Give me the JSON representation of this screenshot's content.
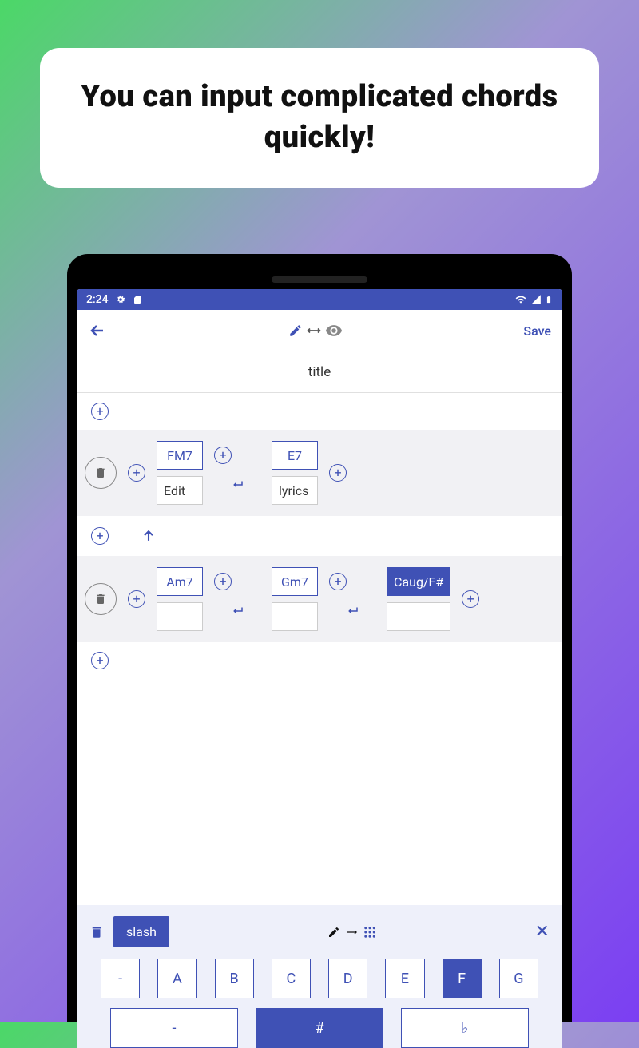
{
  "promo": {
    "headline": "You can input complicated chords quickly!"
  },
  "status": {
    "time": "2:24"
  },
  "appbar": {
    "save_label": "Save"
  },
  "title": {
    "value": "title"
  },
  "rows": [
    {
      "chords": [
        "FM7",
        "E7"
      ],
      "lyrics": [
        "Edit",
        "lyrics"
      ],
      "selected": null
    },
    {
      "chords": [
        "Am7",
        "Gm7",
        "Caug/F#"
      ],
      "lyrics": [
        "",
        "",
        ""
      ],
      "selected": 2
    }
  ],
  "keyboard": {
    "slash_label": "slash",
    "keys_row1": [
      "-",
      "A",
      "B",
      "C",
      "D",
      "E",
      "F",
      "G"
    ],
    "active_row1_index": 6,
    "keys_row2": [
      "-",
      "#",
      "♭"
    ],
    "active_row2_index": 1
  }
}
